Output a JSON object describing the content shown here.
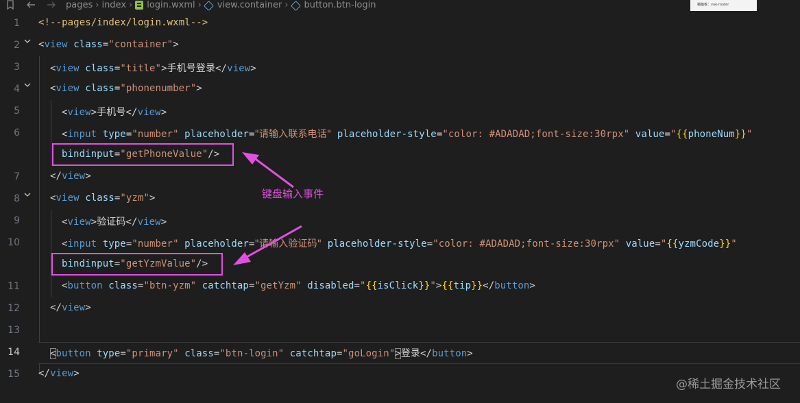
{
  "breadcrumb": {
    "items": [
      "pages",
      "index",
      "login.wxml",
      "view.container",
      "button.btn-login"
    ]
  },
  "minimap_text": "猪脑板：vue-router",
  "lines": [
    {
      "n": "1"
    },
    {
      "n": "2"
    },
    {
      "n": "3"
    },
    {
      "n": "4"
    },
    {
      "n": "5"
    },
    {
      "n": "6"
    },
    {
      "n": "7"
    },
    {
      "n": "8"
    },
    {
      "n": "9"
    },
    {
      "n": "10"
    },
    {
      "n": "11"
    },
    {
      "n": "12"
    },
    {
      "n": "13"
    },
    {
      "n": "14"
    },
    {
      "n": "15"
    }
  ],
  "code": {
    "l1": "<!--pages/index/login.wxml-->",
    "view": "view",
    "button": "button",
    "input": "input",
    "class": "class",
    "type": "type",
    "placeholder": "placeholder",
    "placeholder_style": "placeholder-style",
    "value": "value",
    "bindinput": "bindinput",
    "catchtap": "catchtap",
    "disabled": "disabled",
    "s_container": "\"container\"",
    "s_title": "\"title\"",
    "s_phonenumber": "\"phonenumber\"",
    "s_number": "\"number\"",
    "s_ph_phone": "\"请输入联系电话\"",
    "s_style": "\"color: #ADADAD;font-size:30rpx\"",
    "s_getPhone": "\"getPhoneValue\"",
    "s_yzm": "\"yzm\"",
    "s_ph_yzm": "\"请输入验证码\"",
    "s_getYzm_value": "\"getYzmValue\"",
    "s_btn_yzm": "\"btn-yzm\"",
    "s_getYzm": "\"getYzm\"",
    "s_primary": "\"primary\"",
    "s_btn_login": "\"btn-login\"",
    "s_goLogin": "\"goLogin\"",
    "txt_title": "手机号登录",
    "txt_phone": "手机号",
    "txt_code": "验证码",
    "txt_login": "登录",
    "var_phoneNum": "phoneNum",
    "var_yzmCode": "yzmCode",
    "var_isClick": "isClick",
    "var_tip": "tip"
  },
  "annotation": {
    "label": "键盘输入事件"
  },
  "watermark": "@稀土掘金技术社区",
  "colors": {
    "background": "#1e1e1e",
    "annotation": "#e34fe3",
    "tag": "#569cd6",
    "attribute": "#9cdcfe",
    "string": "#ce9178"
  }
}
